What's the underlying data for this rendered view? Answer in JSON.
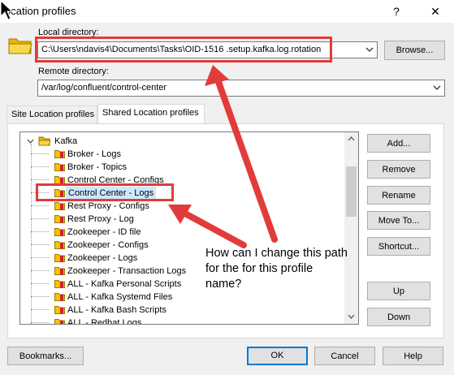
{
  "window": {
    "title": "ocation profiles",
    "help_label": "?",
    "close_label": "✕"
  },
  "local": {
    "label": "Local directory:",
    "value": "C:\\Users\\ndavis4\\Documents\\Tasks\\OID-1516 .setup.kafka.log.rotation",
    "browse_label": "Browse..."
  },
  "remote": {
    "label": "Remote directory:",
    "value": "/var/log/confluent/control-center"
  },
  "tabs": [
    {
      "label": "Site Location profiles"
    },
    {
      "label": "Shared Location profiles"
    }
  ],
  "tree": {
    "root": "Kafka",
    "items": [
      "Broker - Logs",
      "Broker - Topics",
      "Control Center - Configs",
      "Control Center - Logs",
      "Rest Proxy - Configs",
      "Rest Proxy - Log",
      "Zookeeper - ID file",
      "Zookeeper - Configs",
      "Zookeeper - Logs",
      "Zookeeper - Transaction Logs",
      "ALL - Kafka Personal Scripts",
      "ALL - Kafka Systemd Files",
      "ALL - Kafka Bash Scripts",
      "ALL - Redhat Logs"
    ],
    "selected_index": 3
  },
  "side_buttons": {
    "add": "Add...",
    "remove": "Remove",
    "rename": "Rename",
    "move": "Move To...",
    "shortcut": "Shortcut...",
    "up": "Up",
    "down": "Down"
  },
  "bottom_buttons": {
    "bookmarks": "Bookmarks...",
    "ok": "OK",
    "cancel": "Cancel",
    "help": "Help"
  },
  "annotation": {
    "text": "How can I change this path for the for this profile name?"
  },
  "colors": {
    "annotation_red": "#e23b3b",
    "selection": "#cce8ff",
    "folder": "#f5c400",
    "bookmark_red": "#d42020"
  }
}
